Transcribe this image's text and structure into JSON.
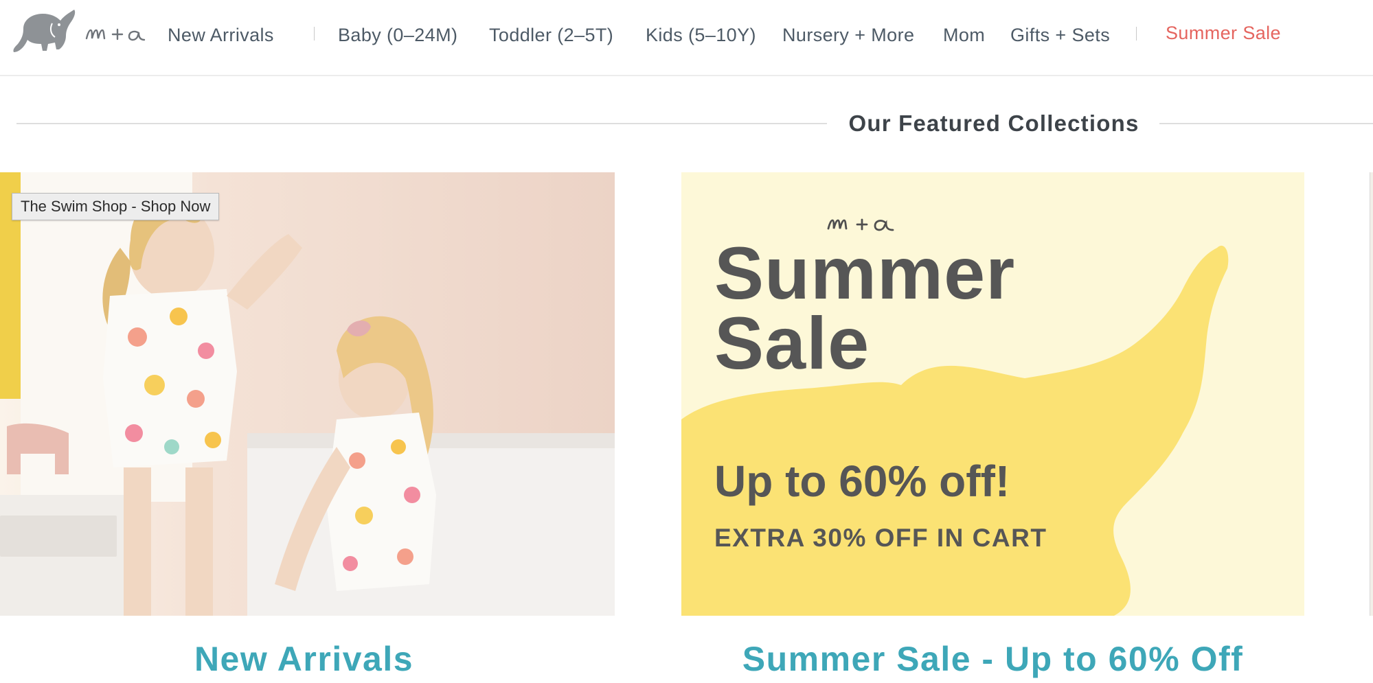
{
  "brand": {
    "logo_icon": "elephant-icon",
    "wordmark": "m+a",
    "colors": {
      "nav_text": "#4d5a66",
      "sale": "#e5655f",
      "caption": "#3ea7b8",
      "promo_bg": "#fdf8d8",
      "promo_elephant": "#fbe274"
    }
  },
  "nav": {
    "items": [
      {
        "label": "New Arrivals"
      },
      {
        "label": "Baby (0–24M)"
      },
      {
        "label": "Toddler (2–5T)"
      },
      {
        "label": "Kids (5–10Y)"
      },
      {
        "label": "Nursery + More"
      },
      {
        "label": "Mom"
      },
      {
        "label": "Gifts + Sets"
      },
      {
        "label": "Summer Sale"
      }
    ]
  },
  "section": {
    "title": "Our Featured Collections"
  },
  "cards": [
    {
      "caption": "New Arrivals",
      "image_tooltip": "The Swim Shop - Shop Now"
    },
    {
      "caption": "Summer Sale - Up to 60% Off",
      "promo": {
        "wordmark": "m+a",
        "title": "Summer\nSale",
        "offer": "Up to 60% off!",
        "extra": "EXTRA 30% OFF IN CART"
      }
    }
  ]
}
